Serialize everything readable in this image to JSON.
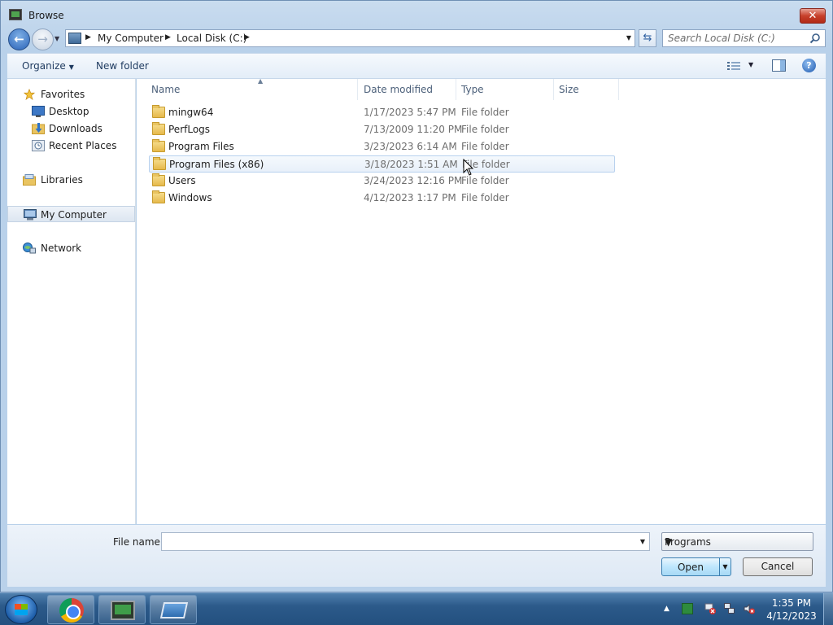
{
  "window": {
    "title": "Browse",
    "close_label": "✕"
  },
  "address": {
    "crumbs": [
      "My Computer",
      "Local Disk (C:)"
    ],
    "search_placeholder": "Search Local Disk (C:)"
  },
  "toolbar": {
    "organize_label": "Organize",
    "new_folder_label": "New folder",
    "help_label": "?"
  },
  "nav_pane": {
    "favorites": "Favorites",
    "desktop": "Desktop",
    "downloads": "Downloads",
    "recent_places": "Recent Places",
    "libraries": "Libraries",
    "my_computer": "My Computer",
    "network": "Network"
  },
  "columns": {
    "name": "Name",
    "date_modified": "Date modified",
    "type": "Type",
    "size": "Size"
  },
  "files": [
    {
      "name": "mingw64",
      "date": "1/17/2023 5:47 PM",
      "type": "File folder"
    },
    {
      "name": "PerfLogs",
      "date": "7/13/2009 11:20 PM",
      "type": "File folder"
    },
    {
      "name": "Program Files",
      "date": "3/23/2023 6:14 AM",
      "type": "File folder"
    },
    {
      "name": "Program Files (x86)",
      "date": "3/18/2023 1:51 AM",
      "type": "File folder"
    },
    {
      "name": "Users",
      "date": "3/24/2023 12:16 PM",
      "type": "File folder"
    },
    {
      "name": "Windows",
      "date": "4/12/2023 1:17 PM",
      "type": "File folder"
    }
  ],
  "bottom": {
    "file_name_label": "File name:",
    "file_name_value": "",
    "file_type_selected": "Programs",
    "open_label": "Open",
    "cancel_label": "Cancel"
  },
  "taskbar": {
    "time": "1:35 PM",
    "date": "4/12/2023"
  }
}
